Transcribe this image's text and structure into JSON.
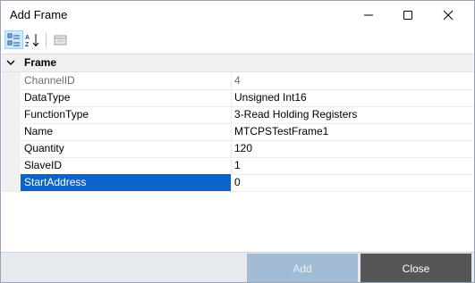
{
  "window": {
    "title": "Add Frame",
    "controls": {
      "minimize_icon": "minimize-icon",
      "maximize_icon": "maximize-icon",
      "close_icon": "close-icon"
    }
  },
  "toolbar": {
    "buttons": [
      {
        "name": "categorized",
        "icon": "categorized-icon",
        "active": true
      },
      {
        "name": "alphabetical",
        "icon": "sort-az-icon",
        "active": false
      },
      {
        "name": "property-pages",
        "icon": "property-pages-icon",
        "active": false
      }
    ]
  },
  "grid": {
    "category": "Frame",
    "properties": [
      {
        "name": "ChannelID",
        "value": "4",
        "readonly": true
      },
      {
        "name": "DataType",
        "value": "Unsigned Int16"
      },
      {
        "name": "FunctionType",
        "value": "3-Read Holding Registers"
      },
      {
        "name": "Name",
        "value": "MTCPSTestFrame1"
      },
      {
        "name": "Quantity",
        "value": "120"
      },
      {
        "name": "SlaveID",
        "value": "1"
      },
      {
        "name": "StartAddress",
        "value": "0",
        "selected": true
      }
    ]
  },
  "footer": {
    "add_label": "Add",
    "close_label": "Close"
  },
  "colors": {
    "selection": "#0a64cc",
    "add_button": "#a3bcd6",
    "close_button": "#565656",
    "footer_bg": "#e6e9ed"
  }
}
